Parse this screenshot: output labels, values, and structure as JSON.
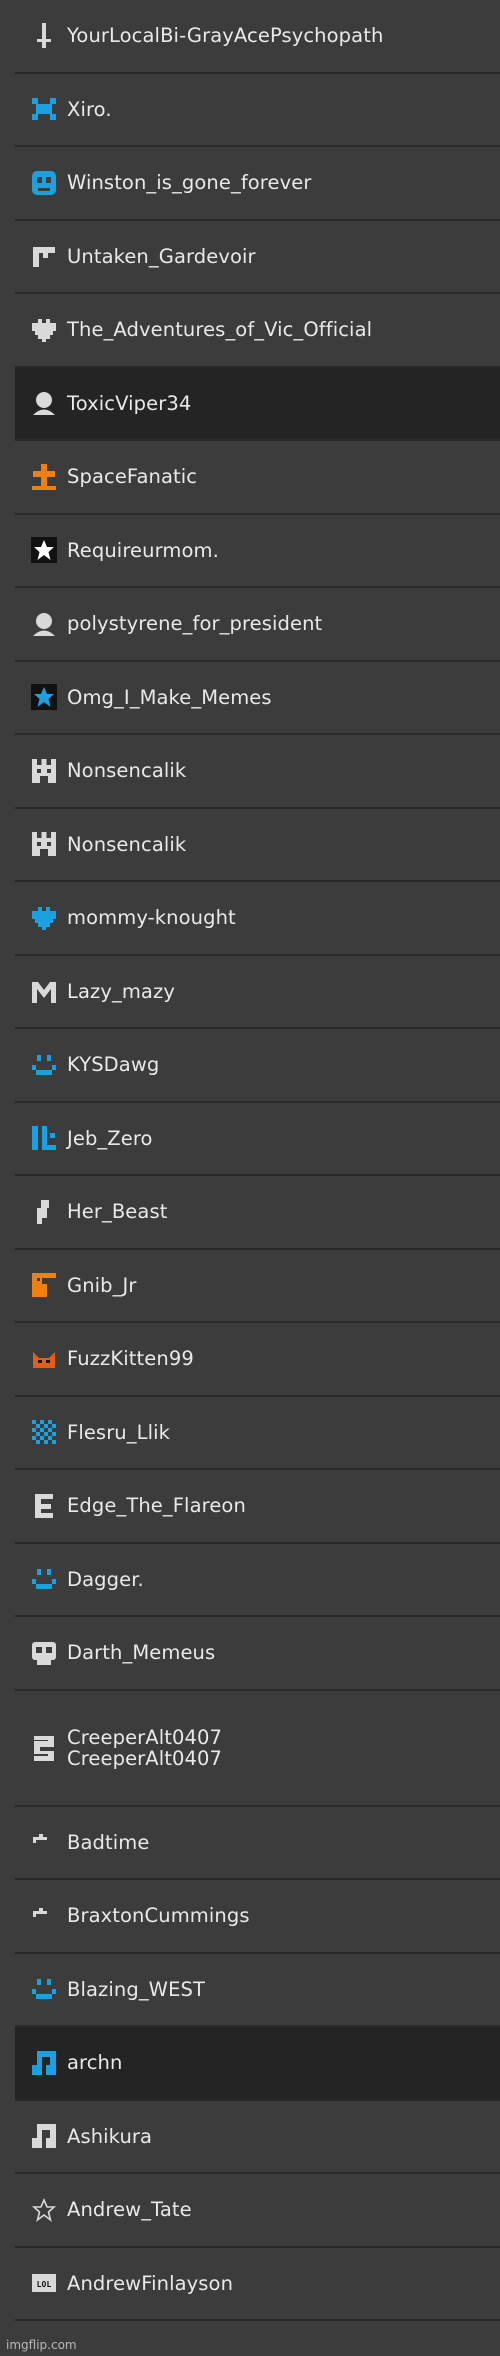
{
  "users": [
    {
      "name": "YourLocalBi-GrayAcePsychopath",
      "icon": "sword-icon",
      "color": "#d9d9d9"
    },
    {
      "name": "Xiro.",
      "icon": "space-invader-icon",
      "color": "#1ba0e2"
    },
    {
      "name": "Winston_is_gone_forever",
      "icon": "ghost-icon",
      "color": "#1ba0e2"
    },
    {
      "name": "Untaken_Gardevoir",
      "icon": "pixel-gun-icon",
      "color": "#d9d9d9"
    },
    {
      "name": "The_Adventures_of_Vic_Official",
      "icon": "pixel-heart-icon",
      "color": "#d9d9d9"
    },
    {
      "name": "ToxicViper34",
      "icon": "default-avatar-icon",
      "color": "#d9d9d9",
      "selected": true
    },
    {
      "name": "SpaceFanatic",
      "icon": "cross-icon",
      "color": "#f08010"
    },
    {
      "name": "Requireurmom.",
      "icon": "star-badge-icon",
      "color": "#ffffff"
    },
    {
      "name": "polystyrene_for_president",
      "icon": "default-avatar-icon",
      "color": "#d9d9d9"
    },
    {
      "name": "Omg_I_Make_Memes",
      "icon": "blue-star-icon",
      "color": "#1ba0e2"
    },
    {
      "name": "Nonsencalik",
      "icon": "castle-icon",
      "color": "#d9d9d9"
    },
    {
      "name": "Nonsencalik",
      "icon": "castle-icon",
      "color": "#d9d9d9"
    },
    {
      "name": "mommy-knought",
      "icon": "pixel-heart-icon",
      "color": "#1ba0e2"
    },
    {
      "name": "Lazy_mazy",
      "icon": "m-icon",
      "color": "#d9d9d9"
    },
    {
      "name": "KYSDawg",
      "icon": "smiley-icon",
      "color": "#1ba0e2"
    },
    {
      "name": "Jeb_Zero",
      "icon": "bars-icon",
      "color": "#1ba0e2"
    },
    {
      "name": "Her_Beast",
      "icon": "pixel-figure-icon",
      "color": "#d9d9d9"
    },
    {
      "name": "Gnib_Jr",
      "icon": "pixel-creature-icon",
      "color": "#f08010"
    },
    {
      "name": "FuzzKitten99",
      "icon": "cat-icon",
      "color": "#e0601a"
    },
    {
      "name": "Flesru_Llik",
      "icon": "checker-icon",
      "color": "#1ba0e2"
    },
    {
      "name": "Edge_The_Flareon",
      "icon": "letter-e-icon",
      "color": "#d9d9d9"
    },
    {
      "name": "Dagger.",
      "icon": "smiley-icon",
      "color": "#1ba0e2"
    },
    {
      "name": "Darth_Memeus",
      "icon": "skull-icon",
      "color": "#d9d9d9"
    },
    {
      "names": [
        "CreeperAlt0407",
        "CreeperAlt0407"
      ],
      "icon": "pixel-snake-icon",
      "color": "#d9d9d9"
    },
    {
      "name": "Badtime",
      "icon": "dash-icon",
      "color": "#d9d9d9"
    },
    {
      "name": "BraxtonCummings",
      "icon": "dash-icon",
      "color": "#d9d9d9"
    },
    {
      "name": "Blazing_WEST",
      "icon": "smiley-icon",
      "color": "#1ba0e2"
    },
    {
      "name": "archn",
      "icon": "music-note-icon",
      "color": "#1ba0e2",
      "selected": true
    },
    {
      "name": "Ashikura",
      "icon": "music-note-icon",
      "color": "#d9d9d9"
    },
    {
      "name": "Andrew_Tate",
      "icon": "star-outline-icon",
      "color": "#d9d9d9"
    },
    {
      "name": "AndrewFinlayson",
      "icon": "lol-icon",
      "color": "#d9d9d9"
    }
  ],
  "watermark": "imgflip.com"
}
